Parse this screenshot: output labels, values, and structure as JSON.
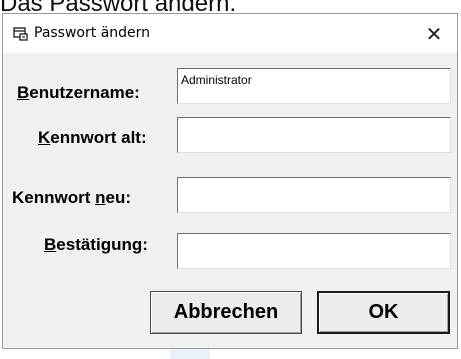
{
  "doc_heading": "Das Passwort ändern.",
  "dialog": {
    "title": "Passwort ändern",
    "close_glyph": "✕"
  },
  "form": {
    "username": {
      "label_first": "B",
      "label_rest": "enutzername:",
      "value": "Administrator"
    },
    "old_password": {
      "label_first": "K",
      "label_rest": "ennwort alt:",
      "value": ""
    },
    "new_password": {
      "label_pre": "Kennwort ",
      "label_underlined": "n",
      "label_post": "eu:",
      "value": ""
    },
    "confirm": {
      "label_first": "B",
      "label_rest": "estätigung:",
      "value": ""
    }
  },
  "buttons": {
    "cancel": "Abbrechen",
    "ok": "OK"
  },
  "icons": {
    "title": "password-dialog-icon",
    "close": "close-icon"
  }
}
